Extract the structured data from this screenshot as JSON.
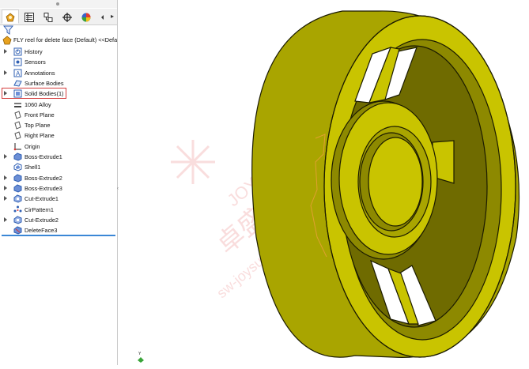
{
  "panel": {
    "tabs": [
      "featuremanager-icon",
      "propertymanager-icon",
      "configurationmanager-icon",
      "dimxpert-icon",
      "display-manager-icon"
    ],
    "root_label": "FLY reel for delete face (Default) <<Defa",
    "items": [
      {
        "label": "History",
        "icon": "history-icon",
        "expandable": true
      },
      {
        "label": "Sensors",
        "icon": "sensors-icon",
        "expandable": false
      },
      {
        "label": "Annotations",
        "icon": "annotations-icon",
        "expandable": true
      },
      {
        "label": "Surface Bodies",
        "icon": "surface-bodies-icon",
        "expandable": false
      },
      {
        "label": "Solid Bodies(1)",
        "icon": "solid-bodies-icon",
        "expandable": true
      },
      {
        "label": "1060 Alloy",
        "icon": "material-icon",
        "expandable": false
      },
      {
        "label": "Front Plane",
        "icon": "plane-icon",
        "expandable": false
      },
      {
        "label": "Top Plane",
        "icon": "plane-icon",
        "expandable": false
      },
      {
        "label": "Right Plane",
        "icon": "plane-icon",
        "expandable": false
      },
      {
        "label": "Origin",
        "icon": "origin-icon",
        "expandable": false
      },
      {
        "label": "Boss-Extrude1",
        "icon": "boss-extrude-icon",
        "expandable": true
      },
      {
        "label": "Shell1",
        "icon": "shell-icon",
        "expandable": false
      },
      {
        "label": "Boss-Extrude2",
        "icon": "boss-extrude-icon",
        "expandable": true
      },
      {
        "label": "Boss-Extrude3",
        "icon": "boss-extrude-icon",
        "expandable": true
      },
      {
        "label": "Cut-Extrude1",
        "icon": "cut-extrude-icon",
        "expandable": true
      },
      {
        "label": "CirPattern1",
        "icon": "circular-pattern-icon",
        "expandable": false
      },
      {
        "label": "Cut-Extrude2",
        "icon": "cut-extrude-icon",
        "expandable": true
      },
      {
        "label": "DeleteFace3",
        "icon": "delete-face-icon",
        "expandable": false
      }
    ]
  },
  "viewport": {
    "watermark_text_1": "JOYSUNSOFT",
    "watermark_text_2": "卓盛信息",
    "watermark_text_3": "sw-joysunsoft",
    "triad_label": "Y",
    "colors": {
      "model_face": "#c9c400",
      "model_shadow": "#6f6b00",
      "model_dark": "#8d8900",
      "edge": "#1b1b00",
      "highlight": "#e0a030"
    }
  }
}
